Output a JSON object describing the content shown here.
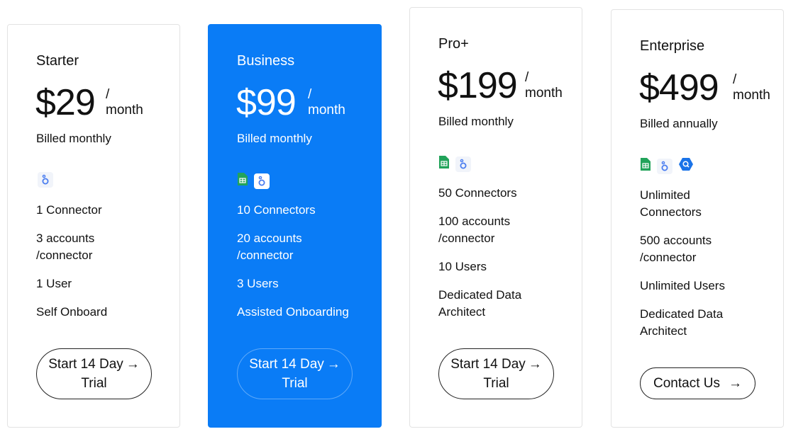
{
  "plans": [
    {
      "name": "Starter",
      "price": "$29",
      "per_slash": "/",
      "per_unit": "month",
      "billing": "Billed monthly",
      "icons": [
        "looker-studio-icon"
      ],
      "features": [
        "1 Connector",
        "3 accounts\n/connector",
        "1 User",
        "Self Onboard"
      ],
      "cta": {
        "line1": "Start 14 Day",
        "line2": "Trial",
        "arrow": "→"
      }
    },
    {
      "name": "Business",
      "price": "$99",
      "per_slash": "/",
      "per_unit": "month",
      "billing": "Billed monthly",
      "highlight_color": "#0a7cf6",
      "icons": [
        "google-sheets-icon",
        "looker-studio-icon"
      ],
      "features": [
        "10 Connectors",
        "20 accounts\n/connector",
        "3 Users",
        "Assisted Onboarding"
      ],
      "cta": {
        "line1": "Start 14 Day",
        "line2": "Trial",
        "arrow": "→"
      }
    },
    {
      "name": "Pro+",
      "price": "$199",
      "per_slash": "/",
      "per_unit": "month",
      "billing": "Billed monthly",
      "icons": [
        "google-sheets-icon",
        "looker-studio-icon"
      ],
      "features": [
        "50 Connectors",
        "100 accounts\n/connector",
        "10 Users",
        "Dedicated Data\nArchitect"
      ],
      "cta": {
        "line1": "Start 14 Day",
        "line2": "Trial",
        "arrow": "→"
      }
    },
    {
      "name": "Enterprise",
      "price": "$499",
      "per_slash": "/",
      "per_unit": "month",
      "billing": "Billed annually",
      "icons": [
        "google-sheets-icon",
        "looker-studio-icon",
        "bigquery-icon"
      ],
      "features": [
        "Unlimited\nConnectors",
        "500 accounts\n/connector",
        "Unlimited Users",
        "Dedicated Data\nArchitect"
      ],
      "cta": {
        "line1": "Contact Us",
        "line2": "",
        "arrow": "→"
      }
    }
  ]
}
